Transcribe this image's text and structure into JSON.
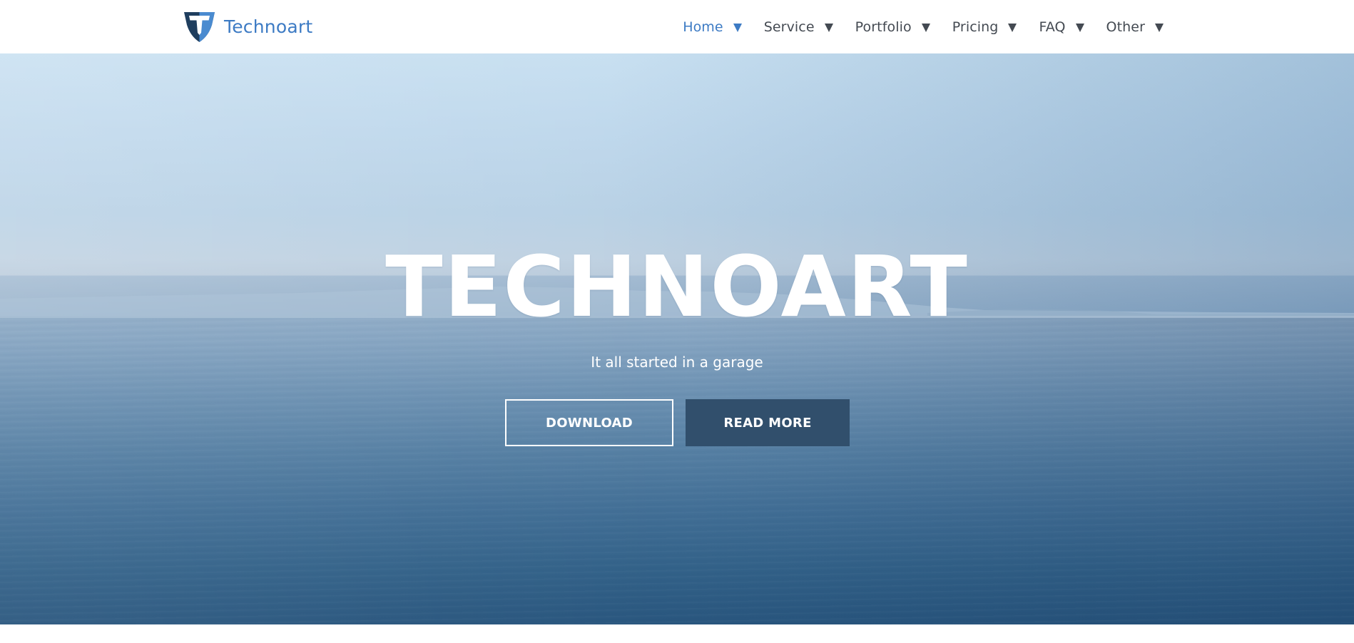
{
  "brand": {
    "name": "Technoart",
    "logo_icon": "shield-t-logo-icon",
    "logo_letter": "T"
  },
  "nav": {
    "items": [
      {
        "label": "Home",
        "active": true,
        "caret_icon": "caret-down-icon"
      },
      {
        "label": "Service",
        "active": false,
        "caret_icon": "caret-down-icon"
      },
      {
        "label": "Portfolio",
        "active": false,
        "caret_icon": "caret-down-icon"
      },
      {
        "label": "Pricing",
        "active": false,
        "caret_icon": "caret-down-icon"
      },
      {
        "label": "FAQ",
        "active": false,
        "caret_icon": "caret-down-icon"
      },
      {
        "label": "Other",
        "active": false,
        "caret_icon": "caret-down-icon"
      }
    ]
  },
  "hero": {
    "title": "TECHNOART",
    "subtitle": "It all started in a garage",
    "background": "calm-sea-horizon-photo",
    "buttons": {
      "download_label": "DOWNLOAD",
      "read_more_label": "READ MORE"
    }
  },
  "colors": {
    "brand_blue": "#3d7bc4",
    "nav_text": "#444a52",
    "button_solid": "#314f6c",
    "hero_text": "#ffffff",
    "logo_dark": "#1f3e5e",
    "logo_light": "#4a8bd0"
  }
}
